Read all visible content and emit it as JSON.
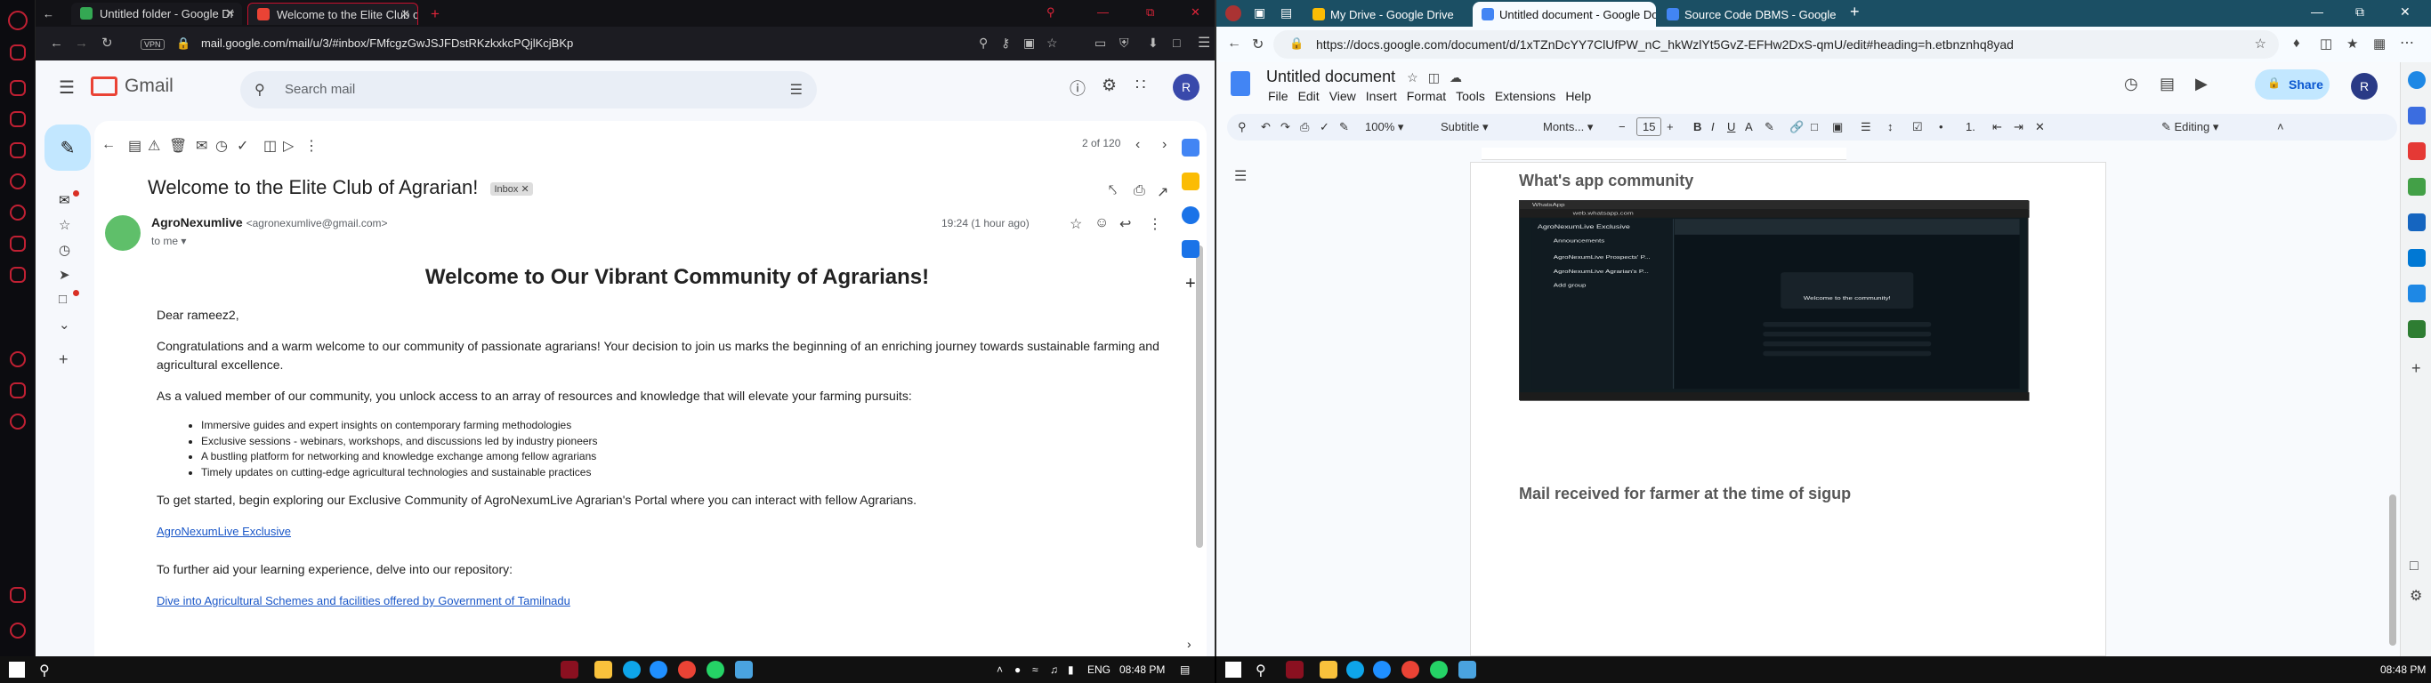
{
  "left_browser": {
    "tabs": [
      {
        "title": "Untitled folder - Google Dr",
        "active": false
      },
      {
        "title": "Welcome to the Elite Club o",
        "active": true
      }
    ],
    "vpn_label": "VPN",
    "url": "mail.google.com/mail/u/3/#inbox/FMfcgzGwJSJFDstRKzkxkcPQjlKcjBKp"
  },
  "gmail": {
    "brand": "Gmail",
    "search_placeholder": "Search mail",
    "avatar_letter": "R",
    "counter": "2 of 120",
    "subject": "Welcome to the Elite Club of Agrarian!",
    "inbox_chip": "Inbox",
    "sender_name": "AgroNexumlive",
    "sender_email": "<agronexumlive@gmail.com>",
    "to_me": "to me",
    "time": "19:24 (1 hour ago)",
    "heading": "Welcome to Our Vibrant Community of Agrarians!",
    "greeting": "Dear rameez2,",
    "para1": "Congratulations and a warm welcome to our community of passionate agrarians! Your decision to join us marks the beginning of an enriching journey towards sustainable farming and agricultural excellence.",
    "para2": "As a valued member of our community, you unlock access to an array of resources and knowledge that will elevate your farming pursuits:",
    "bullets": [
      "Immersive guides and expert insights on contemporary farming methodologies",
      "Exclusive sessions - webinars, workshops, and discussions led by industry pioneers",
      "A bustling platform for networking and knowledge exchange among fellow agrarians",
      "Timely updates on cutting-edge agricultural technologies and sustainable practices"
    ],
    "para3": "To get started, begin exploring our Exclusive Community of AgroNexumLive Agrarian's Portal where you can interact with fellow Agrarians.",
    "link1": "AgroNexumLive Exclusive",
    "para4": "To further aid your learning experience, delve into our repository:",
    "link2": "Dive into Agricultural Schemes and facilities offered by Government of Tamilnadu"
  },
  "right_browser": {
    "tabs": [
      {
        "title": "My Drive - Google Drive",
        "active": false
      },
      {
        "title": "Untitled document - Google Do",
        "active": true
      },
      {
        "title": "Source Code DBMS - Google Do",
        "active": false
      }
    ],
    "url": "https://docs.google.com/document/d/1xTZnDcYY7ClUfPW_nC_hkWzlYt5GvZ-EFHw2DxS-qmU/edit#heading=h.etbnznhq8yad"
  },
  "docs": {
    "title": "Untitled document",
    "menu": [
      "File",
      "Edit",
      "View",
      "Insert",
      "Format",
      "Tools",
      "Extensions",
      "Help"
    ],
    "share_label": "Share",
    "avatar_letter": "R",
    "zoom": "100%",
    "style": "Subtitle",
    "font": "Monts...",
    "font_size": "15",
    "mode": "Editing",
    "heading1": "What's app community",
    "heading2": "Mail received for farmer at the time of sigup",
    "screenshot": {
      "tab": "WhatsApp",
      "url": "web.whatsapp.com",
      "community": "AgroNexumLive Exclusive",
      "community_sub": "Announcements",
      "group1": "AgroNexumLive Prospects' P...",
      "group2": "AgroNexumLive Agrarian's P...",
      "add_group": "Add group",
      "welcome": "Welcome to the community!"
    }
  },
  "taskbar": {
    "lang": "ENG",
    "time_left": "08:48 PM",
    "time_right": "08:48 PM"
  }
}
